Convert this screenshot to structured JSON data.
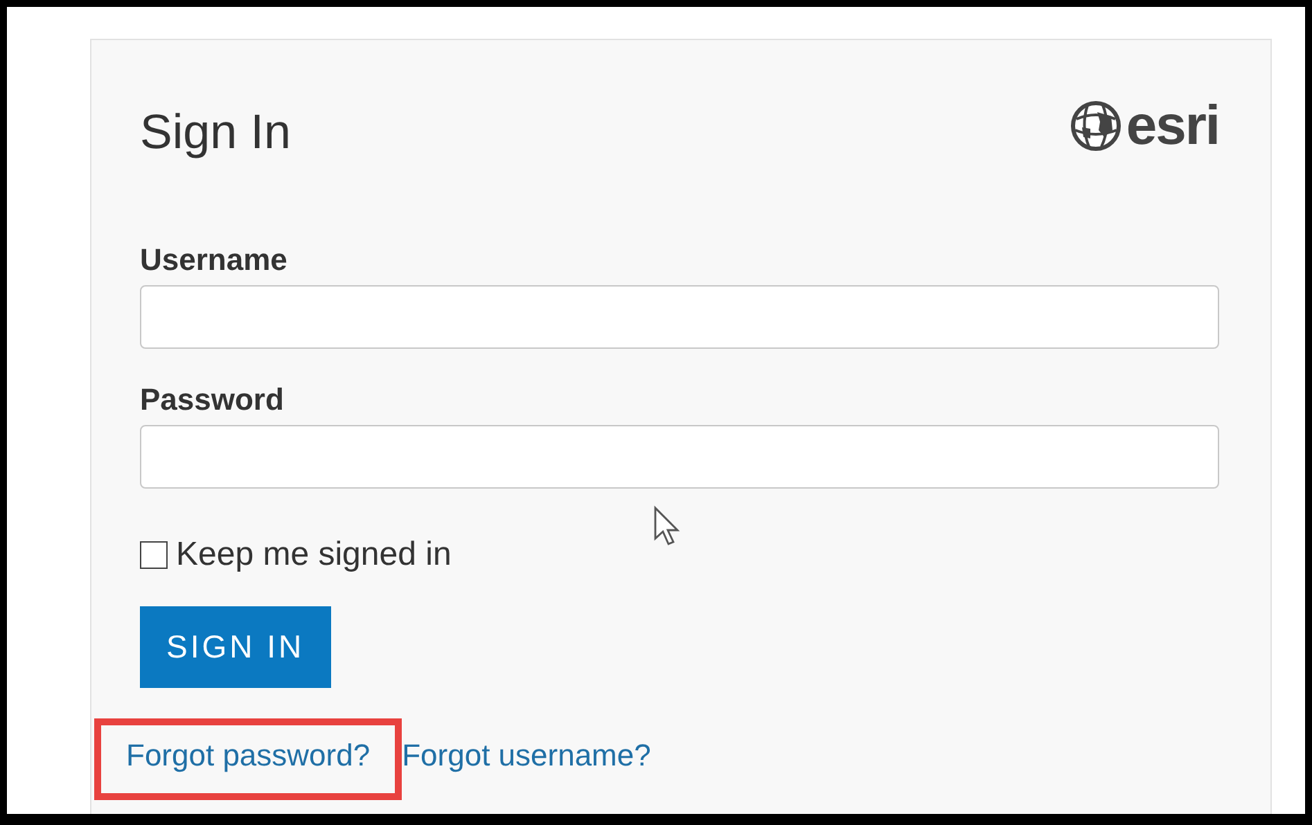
{
  "title": "Sign In",
  "logo": {
    "text": "esri"
  },
  "fields": [
    {
      "label": "Username"
    },
    {
      "label": "Password"
    }
  ],
  "remember": {
    "label": "Keep me signed in",
    "checked": false
  },
  "submit": "SIGN IN",
  "links": [
    {
      "label": "Forgot password?",
      "highlighted": true
    },
    {
      "label": "Forgot username?",
      "highlighted": false
    }
  ]
}
